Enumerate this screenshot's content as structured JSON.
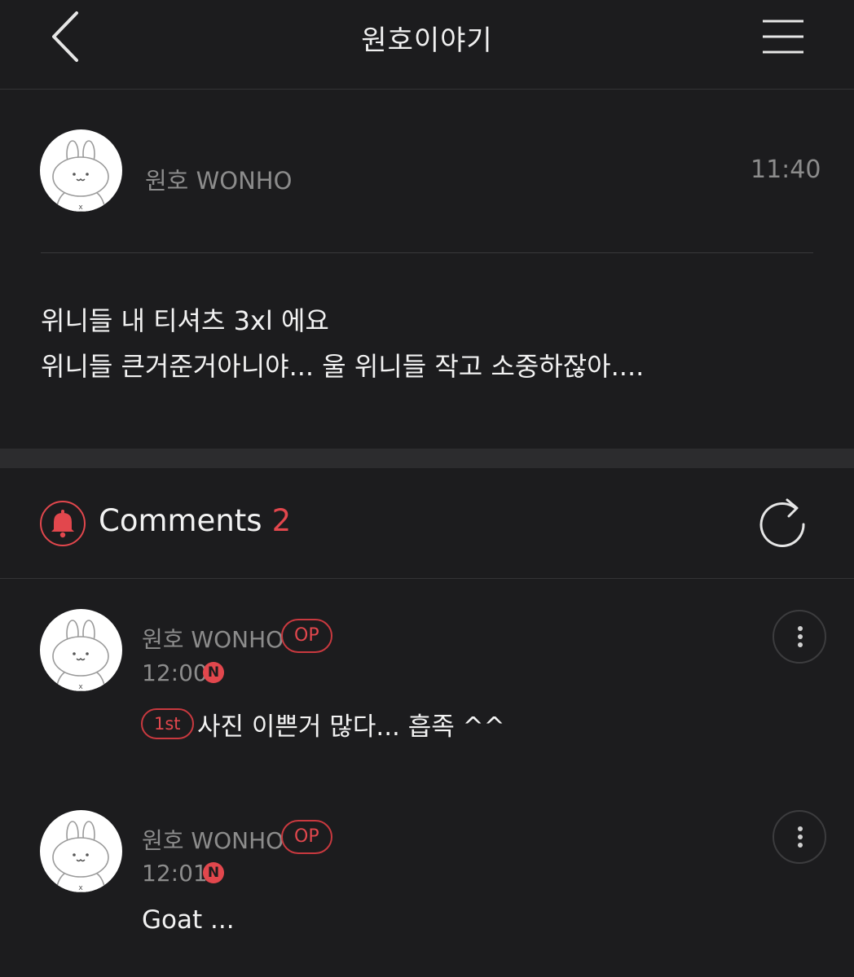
{
  "header": {
    "title": "원호이야기"
  },
  "post": {
    "author": "원호 WONHO",
    "time": "11:40",
    "lines": [
      "위니들 내 티셔츠 3xl 에요",
      "위니들 큰거준거아니야... 울 위니들 작고 소중하잖아...."
    ]
  },
  "comments_section": {
    "label": "Comments",
    "count": "2"
  },
  "comments": [
    {
      "author": "원호 WONHO",
      "badge": "OP",
      "time": "12:00",
      "new_badge": "N",
      "rank": "1st",
      "text": "사진 이쁜거 많다... 흡족 ^^"
    },
    {
      "author": "원호 WONHO",
      "badge": "OP",
      "time": "12:01",
      "new_badge": "N",
      "text": "Goat ..."
    }
  ],
  "colors": {
    "background": "#1c1c1e",
    "accent": "#e2474d",
    "muted_text": "#8c8c8c"
  },
  "icons": [
    "chevron-left-icon",
    "hamburger-menu-icon",
    "bunny-avatar-icon",
    "bell-icon",
    "refresh-icon",
    "more-vertical-icon",
    "new-badge-icon"
  ]
}
